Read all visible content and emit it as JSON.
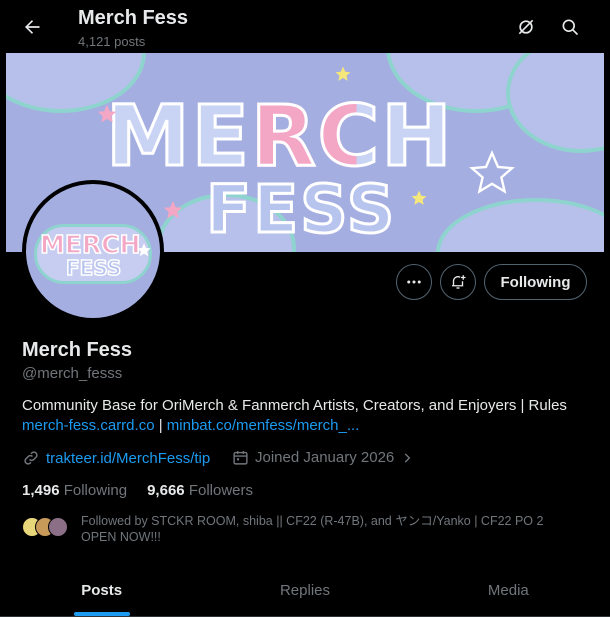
{
  "header": {
    "title": "Merch Fess",
    "post_count": "4,121 posts"
  },
  "banner": {
    "line1": "MERCH",
    "line2": "FESS"
  },
  "avatar": {
    "line1": "MERCH",
    "line2": "FESS"
  },
  "actions": {
    "following_label": "Following"
  },
  "profile": {
    "name": "Merch Fess",
    "handle": "@merch_fesss",
    "bio_text": "Community Base for OriMerch & Fanmerch Artists, Creators, and Enjoyers | Rules",
    "bio_link1": "merch-fess.carrd.co",
    "bio_sep": " | ",
    "bio_link2": "minbat.co/menfess/merch_...",
    "website": "trakteer.id/MerchFess/tip",
    "joined": "Joined January 2026",
    "following_count": "1,496",
    "following_label": "Following",
    "followers_count": "9,666",
    "followers_label": "Followers",
    "followed_by": "Followed by STCKR ROOM, shiba || CF22 (R-47B), and ヤンコ/Yanko | CF22 PO 2 OPEN NOW!!!"
  },
  "tabs": [
    {
      "label": "Posts",
      "active": true
    },
    {
      "label": "Replies",
      "active": false
    },
    {
      "label": "Media",
      "active": false
    }
  ],
  "colors": {
    "accent": "#1d9bf0",
    "banner_bg": "#a4aee0",
    "pink": "#f4a6c5",
    "cloud_outline": "#8fd3cf"
  }
}
